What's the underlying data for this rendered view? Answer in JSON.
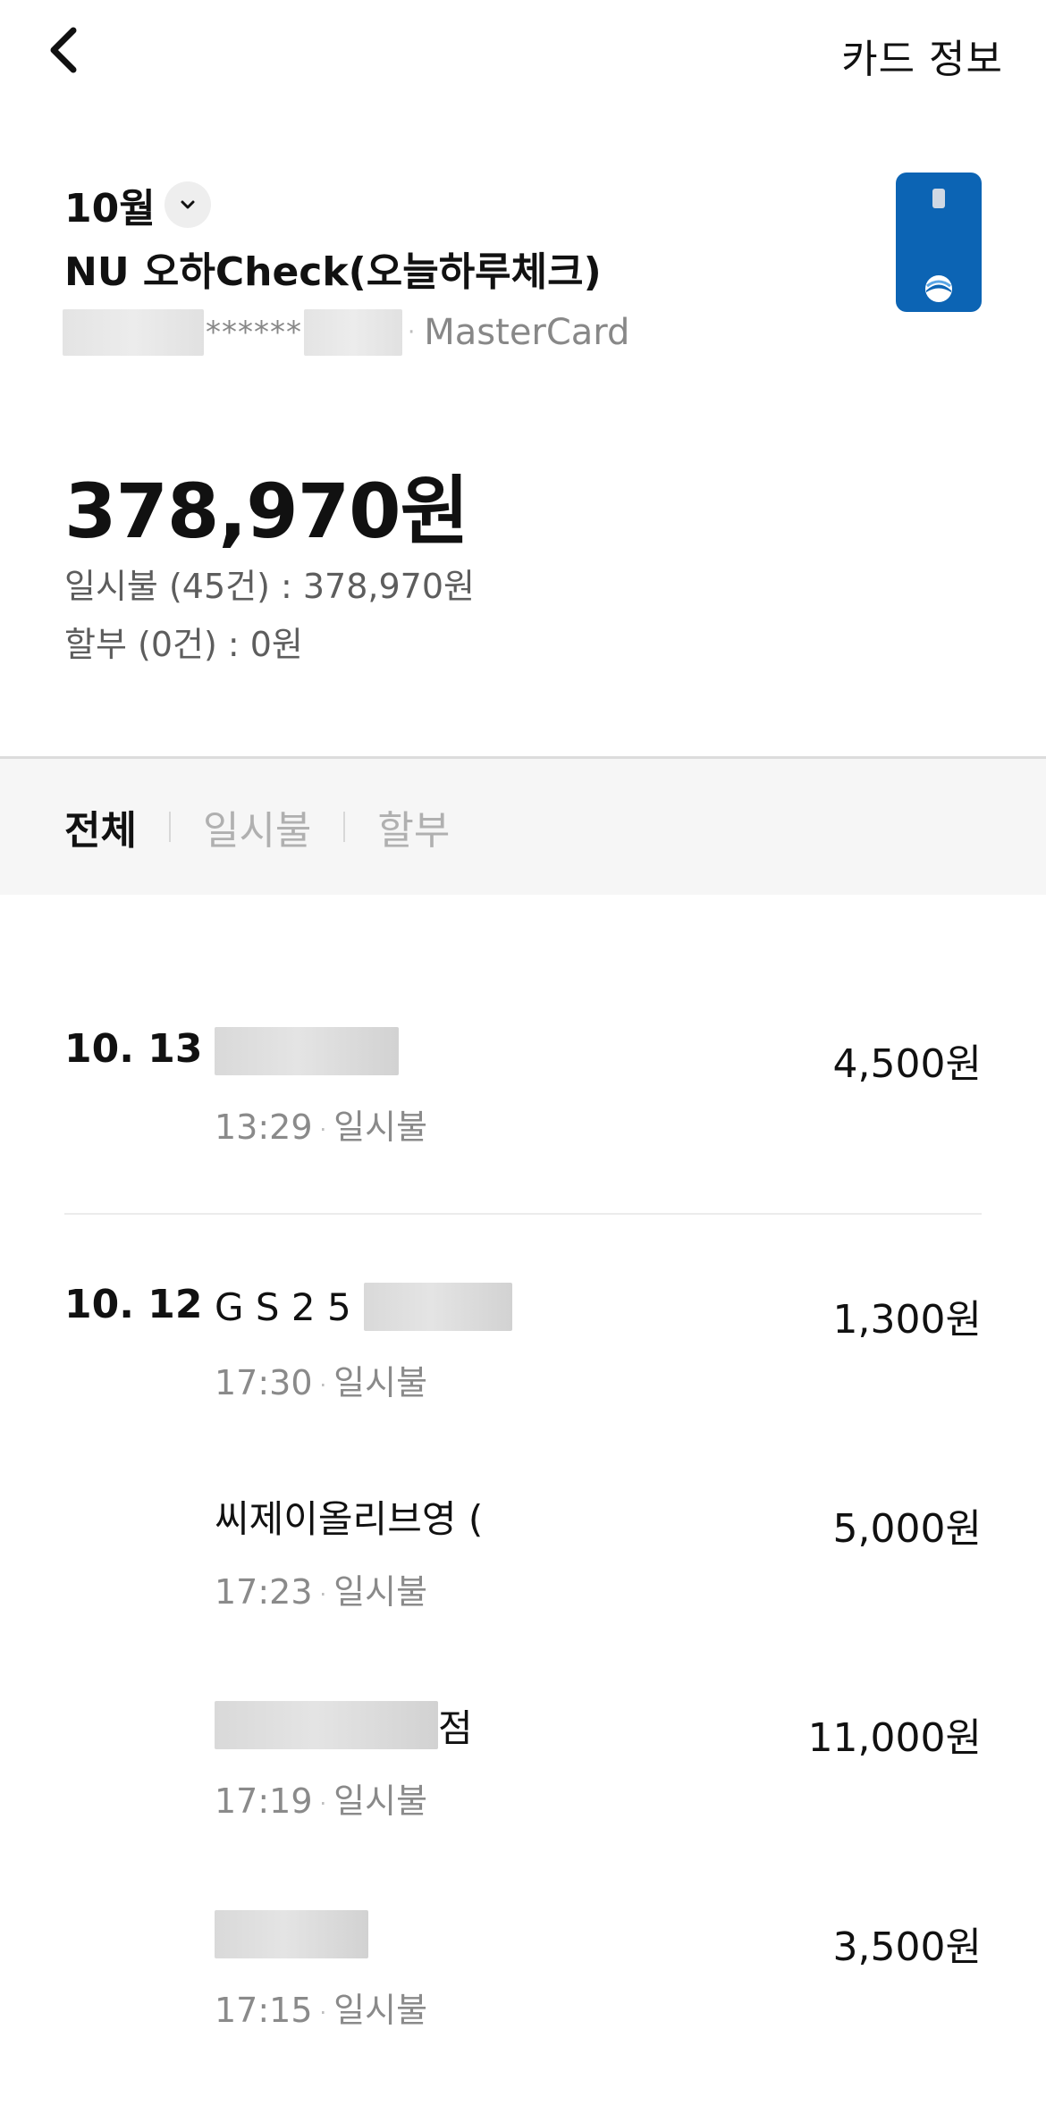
{
  "header": {
    "card_info_label": "카드 정보",
    "month": "10월",
    "card_name": "NU 오하Check(오늘하루체크)",
    "card_number_stars": "******",
    "card_brand": "MasterCard"
  },
  "summary": {
    "total": "378,970원",
    "lump_sum": "일시불 (45건) : 378,970원",
    "installment": "할부 (0건) : 0원"
  },
  "tabs": [
    {
      "label": "전체",
      "active": true
    },
    {
      "label": "일시불",
      "active": false
    },
    {
      "label": "할부",
      "active": false
    }
  ],
  "transactions": [
    {
      "date": "10. 13",
      "merchant": "",
      "time": "13:29",
      "type": "일시불",
      "amount": "4,500원"
    },
    {
      "date": "10. 12",
      "merchant": "G S 2 5",
      "time": "17:30",
      "type": "일시불",
      "amount": "1,300원"
    },
    {
      "date": "",
      "merchant": "씨제이올리브영 (",
      "time": "17:23",
      "type": "일시불",
      "amount": "5,000원"
    },
    {
      "date": "",
      "merchant": "점",
      "time": "17:19",
      "type": "일시불",
      "amount": "11,000원"
    },
    {
      "date": "",
      "merchant": "",
      "time": "17:15",
      "type": "일시불",
      "amount": "3,500원"
    }
  ],
  "colors": {
    "card_blue": "#0c64b4",
    "muted_text": "#8a8a8a",
    "tab_background": "#f6f6f6"
  }
}
